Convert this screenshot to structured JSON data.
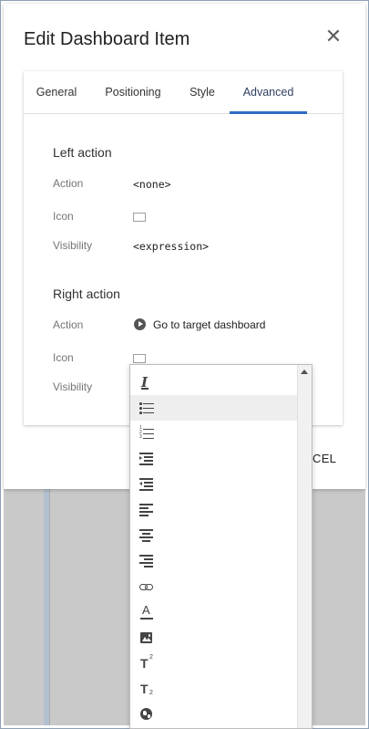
{
  "dialog": {
    "title": "Edit Dashboard Item",
    "close_glyph": "✕",
    "cancel_label": "CEL"
  },
  "tabs": [
    {
      "label": "General",
      "active": false
    },
    {
      "label": "Positioning",
      "active": false
    },
    {
      "label": "Style",
      "active": false
    },
    {
      "label": "Advanced",
      "active": true
    }
  ],
  "left_action": {
    "title": "Left action",
    "action_label": "Action",
    "action_value": "<none>",
    "icon_label": "Icon",
    "visibility_label": "Visibility",
    "visibility_value": "<expression>"
  },
  "right_action": {
    "title": "Right action",
    "action_label": "Action",
    "action_value": "Go to target dashboard",
    "icon_label": "Icon",
    "visibility_label": "Visibility"
  },
  "dropdown": {
    "selected_index": 1,
    "items": [
      {
        "icon": "clear-formatting-icon"
      },
      {
        "icon": "bulleted-list-icon"
      },
      {
        "icon": "numbered-list-icon"
      },
      {
        "icon": "indent-icon"
      },
      {
        "icon": "outdent-icon"
      },
      {
        "icon": "align-left-icon"
      },
      {
        "icon": "align-center-icon"
      },
      {
        "icon": "align-right-icon"
      },
      {
        "icon": "link-icon"
      },
      {
        "icon": "text-color-icon"
      },
      {
        "icon": "image-icon"
      },
      {
        "icon": "superscript-icon"
      },
      {
        "icon": "subscript-icon"
      },
      {
        "icon": "globe-icon"
      }
    ]
  },
  "colors": {
    "accent": "#2d6dc1",
    "backdrop": "#c9c9c9",
    "selected_item": "#eeeeee"
  }
}
